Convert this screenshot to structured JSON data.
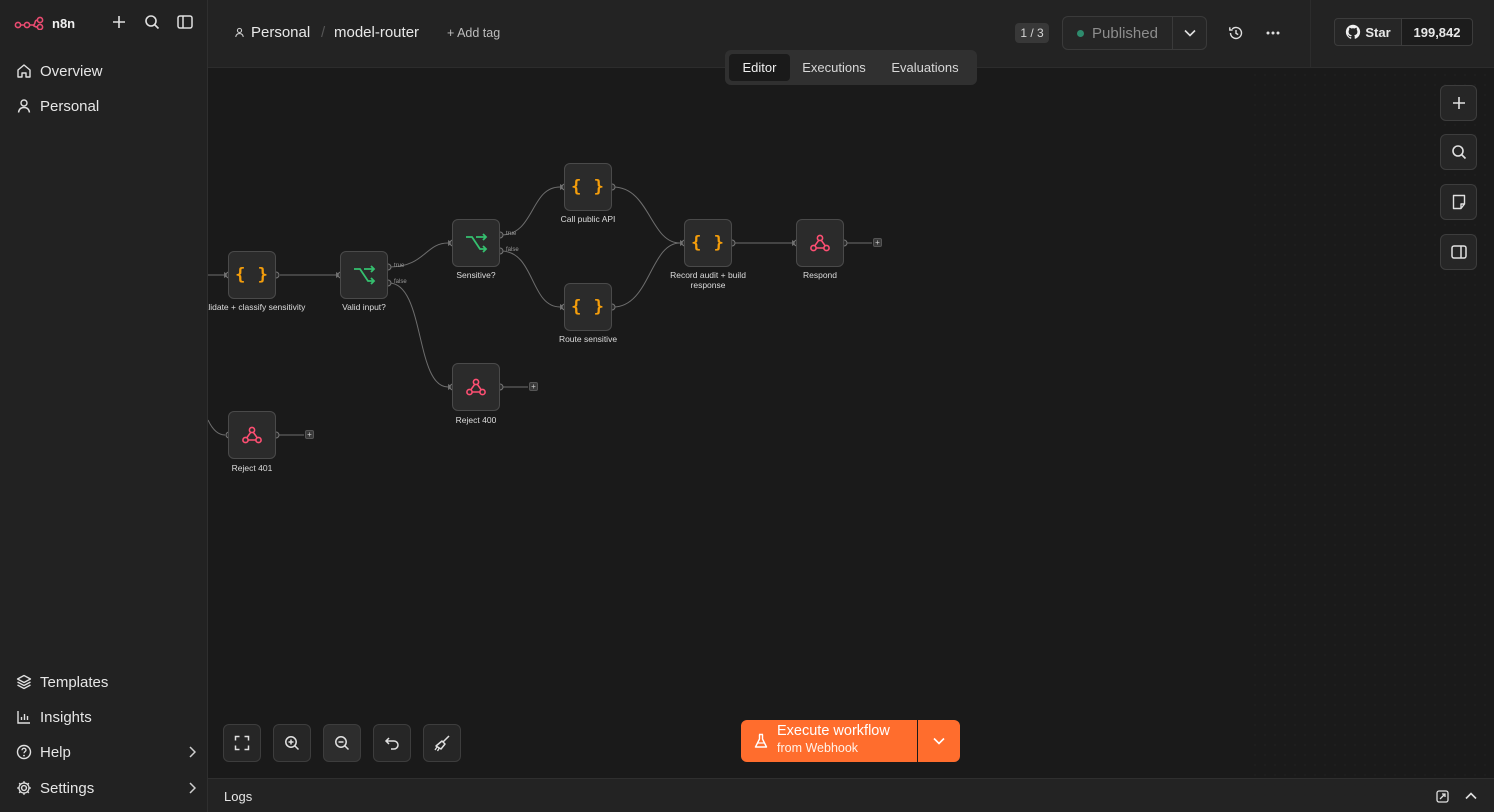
{
  "app": {
    "name": "n8n"
  },
  "sidebar": {
    "top": [
      {
        "label": "Overview",
        "icon": "home-icon"
      },
      {
        "label": "Personal",
        "icon": "user-icon"
      }
    ],
    "bottom": [
      {
        "label": "Templates",
        "icon": "templates-icon"
      },
      {
        "label": "Insights",
        "icon": "chart-icon"
      },
      {
        "label": "Help",
        "icon": "help-icon"
      },
      {
        "label": "Settings",
        "icon": "gear-icon"
      }
    ]
  },
  "header": {
    "project": "Personal",
    "workflow": "model-router",
    "add_tag": "+ Add tag",
    "version_counter": "1 / 3",
    "publish_label": "Published",
    "github": {
      "star_label": "Star",
      "count": "199,842"
    }
  },
  "tabs": [
    {
      "label": "Editor",
      "active": true
    },
    {
      "label": "Executions",
      "active": false
    },
    {
      "label": "Evaluations",
      "active": false
    }
  ],
  "workflow": {
    "nodes": [
      {
        "id": "validate",
        "label": "Validate + classify sensitivity",
        "type": "code",
        "icon": "code-braces-icon"
      },
      {
        "id": "valid_input",
        "label": "Valid input?",
        "type": "if",
        "icon": "branch-icon"
      },
      {
        "id": "sensitive",
        "label": "Sensitive?",
        "type": "if",
        "icon": "branch-icon"
      },
      {
        "id": "call_public",
        "label": "Call public API",
        "type": "code",
        "icon": "code-braces-icon"
      },
      {
        "id": "route_sensitive",
        "label": "Route sensitive",
        "type": "code",
        "icon": "code-braces-icon"
      },
      {
        "id": "record_audit",
        "label": "Record audit + build response",
        "type": "code",
        "icon": "code-braces-icon"
      },
      {
        "id": "respond",
        "label": "Respond",
        "type": "webhook",
        "icon": "webhook-icon"
      },
      {
        "id": "reject_400",
        "label": "Reject 400",
        "type": "webhook",
        "icon": "webhook-icon"
      },
      {
        "id": "reject_401",
        "label": "Reject 401",
        "type": "webhook",
        "icon": "webhook-icon"
      }
    ],
    "port_labels": {
      "true": "true",
      "false": "false"
    }
  },
  "execute": {
    "main": "Execute workflow",
    "sub": "from Webhook"
  },
  "logs": {
    "label": "Logs"
  },
  "colors": {
    "accent": "#ff6d2d",
    "code": "#f59e0b",
    "if": "#35c06f",
    "webhook": "#ff4f73"
  }
}
